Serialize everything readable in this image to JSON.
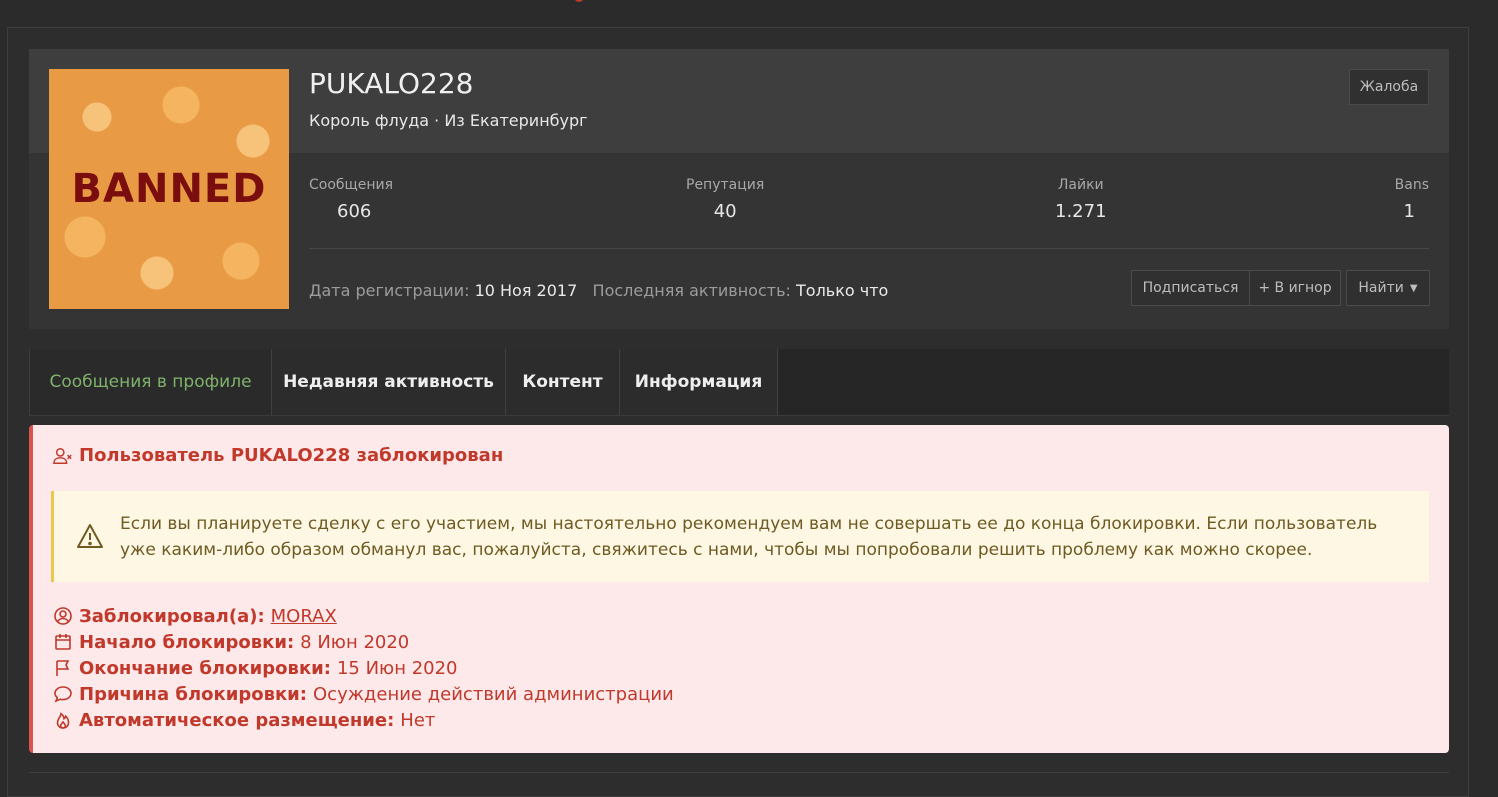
{
  "profile": {
    "avatar_text": "BANNED",
    "username": "PUKALO228",
    "title_line": "Король флуда · Из Екатеринбург",
    "report_label": "Жалоба",
    "stats": [
      {
        "label": "Сообщения",
        "value": "606"
      },
      {
        "label": "Репутация",
        "value": "40"
      },
      {
        "label": "Лайки",
        "value": "1.271"
      },
      {
        "label": "Bans",
        "value": "1"
      }
    ],
    "registered_label": "Дата регистрации:",
    "registered_value": "10 Ноя 2017",
    "last_activity_label": "Последняя активность:",
    "last_activity_value": "Только что",
    "subscribe_label": "Подписаться",
    "ignore_label": "+ В игнор",
    "find_label": "Найти"
  },
  "tabs": [
    {
      "label": "Сообщения в профиле",
      "active": true
    },
    {
      "label": "Недавняя активность",
      "active": false
    },
    {
      "label": "Контент",
      "active": false
    },
    {
      "label": "Информация",
      "active": false
    }
  ],
  "ban": {
    "title": "Пользователь PUKALO228 заблокирован",
    "warning": "Если вы планируете сделку с его участием, мы настоятельно рекомендуем вам не совершать ее до конца блокировки. Если пользователь уже каким-либо образом обманул вас, пожалуйста, свяжитесь с нами, чтобы мы попробовали решить проблему как можно скорее.",
    "rows": [
      {
        "icon": "user-circle-icon",
        "key": "Заблокировал(а):",
        "value": "MORAX",
        "link": true
      },
      {
        "icon": "calendar-icon",
        "key": "Начало блокировки:",
        "value": "8 Июн 2020",
        "link": false
      },
      {
        "icon": "flag-icon",
        "key": "Окончание блокировки:",
        "value": "15 Июн 2020",
        "link": false
      },
      {
        "icon": "comment-icon",
        "key": "Причина блокировки:",
        "value": "Осуждение действий администрации",
        "link": false
      },
      {
        "icon": "fire-icon",
        "key": "Автоматическое размещение:",
        "value": "Нет",
        "link": false
      }
    ]
  },
  "colors": {
    "accent_green": "#7fb26a",
    "ban_red": "#c0392b",
    "ban_bg": "#fde8ea",
    "warn_bg": "#fdf7e3"
  }
}
